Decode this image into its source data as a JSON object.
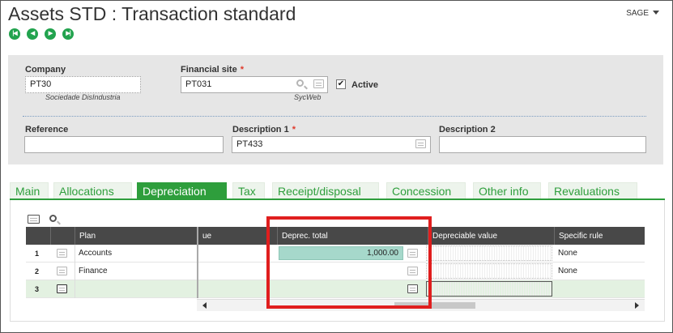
{
  "header": {
    "title": "Assets STD : Transaction standard",
    "user": "SAGE"
  },
  "nav_buttons": [
    "first",
    "previous",
    "next",
    "last"
  ],
  "form": {
    "company": {
      "label": "Company",
      "value": "PT30",
      "caption": "Sociedade DisIndustria"
    },
    "financial_site": {
      "label": "Financial site",
      "value": "PT031",
      "caption": "SycWeb",
      "required": true
    },
    "active": {
      "label": "Active",
      "checked": true
    },
    "reference": {
      "label": "Reference",
      "value": ""
    },
    "description1": {
      "label": "Description 1",
      "value": "PT433",
      "required": true
    },
    "description2": {
      "label": "Description 2",
      "value": ""
    },
    "required_mark": "*"
  },
  "tabs": [
    {
      "label": "Main",
      "active": false
    },
    {
      "label": "Allocations",
      "active": false
    },
    {
      "label": "Depreciation",
      "active": true
    },
    {
      "label": "Tax",
      "active": false
    },
    {
      "label": "Receipt/disposal",
      "active": false
    },
    {
      "label": "Concession",
      "active": false
    },
    {
      "label": "Other info",
      "active": false
    },
    {
      "label": "Revaluations",
      "active": false
    }
  ],
  "grid": {
    "columns": {
      "plan": "Plan",
      "value_partial": "ue",
      "deprec_total": "Deprec. total",
      "depreciable_value": "Depreciable value",
      "specific_rule": "Specific rule"
    },
    "rows": [
      {
        "num": "1",
        "plan": "Accounts",
        "deprec_total": "1,000.00",
        "specific_rule": "None"
      },
      {
        "num": "2",
        "plan": "Finance",
        "deprec_total": "",
        "specific_rule": "None"
      },
      {
        "num": "3",
        "plan": "",
        "deprec_total": "",
        "specific_rule": ""
      }
    ]
  },
  "colors": {
    "accent_green": "#2e9e3c",
    "nav_green": "#22a34e",
    "highlight_box": "#e01e1e",
    "grid_header": "#484848",
    "edited_cell": "#a6d8cb"
  }
}
